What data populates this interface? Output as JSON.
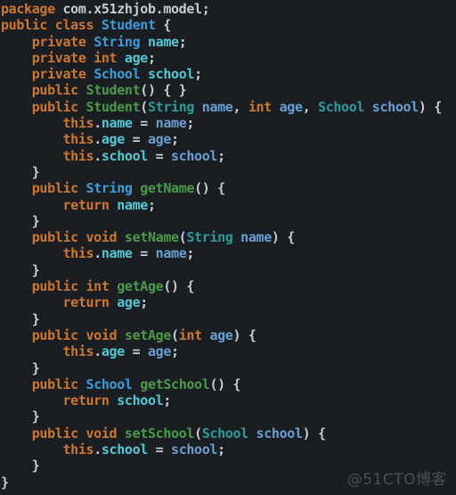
{
  "editor": {
    "language": "java",
    "background_color": "#1a1d21",
    "font_size_px": 15,
    "line_height_px": 18.3,
    "tab_width": 4,
    "total_lines": 30
  },
  "theme": {
    "keyword_color": "#cc7832",
    "type_color": "#3f9cd6",
    "param_type_color": "#2e9c9c",
    "method_color": "#4b9b4b",
    "field_color": "#52c9d4",
    "parameter_color": "#6a9fd4",
    "punctuation_color": "#c8cdd4"
  },
  "code": {
    "package_keyword": "package",
    "package_name": "com.x51zhjob.model",
    "class_modifier": "public",
    "class_keyword": "class",
    "class_name": "Student",
    "lines": [
      "package com.x51zhjob.model;",
      "public class Student {",
      "    private String name;",
      "    private int age;",
      "    private School school;",
      "    public Student() { }",
      "    public Student(String name, int age, School school) {",
      "        this.name = name;",
      "        this.age = age;",
      "        this.school = school;",
      "    }",
      "    public String getName() {",
      "        return name;",
      "    }",
      "    public void setName(String name) {",
      "        this.name = name;",
      "    }",
      "    public int getAge() {",
      "        return age;",
      "    }",
      "    public void setAge(int age) {",
      "        this.age = age;",
      "    }",
      "    public School getSchool() {",
      "        return school;",
      "    }",
      "    public void setSchool(School school) {",
      "        this.school = school;",
      "    }",
      "}"
    ],
    "fields": [
      {
        "modifier": "private",
        "type": "String",
        "name": "name"
      },
      {
        "modifier": "private",
        "type": "int",
        "name": "age"
      },
      {
        "modifier": "private",
        "type": "School",
        "name": "school"
      }
    ],
    "methods": [
      {
        "modifier": "public",
        "return_type": "",
        "name": "Student",
        "params": ""
      },
      {
        "modifier": "public",
        "return_type": "",
        "name": "Student",
        "params": "String name, int age, School school"
      },
      {
        "modifier": "public",
        "return_type": "String",
        "name": "getName",
        "params": ""
      },
      {
        "modifier": "public",
        "return_type": "void",
        "name": "setName",
        "params": "String name"
      },
      {
        "modifier": "public",
        "return_type": "int",
        "name": "getAge",
        "params": ""
      },
      {
        "modifier": "public",
        "return_type": "void",
        "name": "setAge",
        "params": "int age"
      },
      {
        "modifier": "public",
        "return_type": "School",
        "name": "getSchool",
        "params": ""
      },
      {
        "modifier": "public",
        "return_type": "void",
        "name": "setSchool",
        "params": "School school"
      }
    ]
  },
  "watermark": {
    "text": "@51CTO博客"
  }
}
